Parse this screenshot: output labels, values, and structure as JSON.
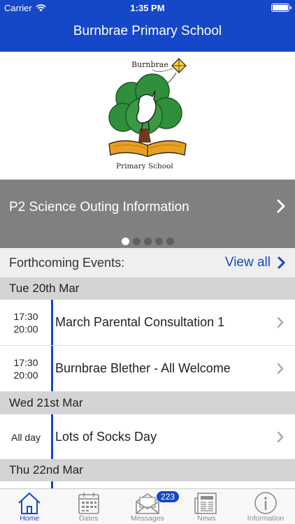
{
  "status_bar": {
    "carrier": "Carrier",
    "time": "1:35 PM"
  },
  "nav": {
    "title": "Burnbrae Primary School"
  },
  "logo": {
    "top_text": "Burnbrae",
    "bottom_text": "Primary School"
  },
  "carousel": {
    "title": "P2 Science Outing Information",
    "page_count": 5,
    "active_index": 0
  },
  "events": {
    "header_label": "Forthcoming Events:",
    "view_all_label": "View all",
    "days": [
      {
        "label": "Tue 20th Mar",
        "items": [
          {
            "start": "17:30",
            "end": "20:00",
            "title": "March Parental Consultation 1"
          },
          {
            "start": "17:30",
            "end": "20:00",
            "title": "Burnbrae Blether - All Welcome"
          }
        ]
      },
      {
        "label": "Wed 21st Mar",
        "items": [
          {
            "all_day": "All day",
            "title": "Lots of Socks Day"
          }
        ]
      },
      {
        "label": "Thu 22nd Mar",
        "items": []
      }
    ]
  },
  "tabbar": {
    "tabs": [
      {
        "label": "Home",
        "icon": "home-icon",
        "active": true
      },
      {
        "label": "Dates",
        "icon": "calendar-icon"
      },
      {
        "label": "Messages",
        "icon": "envelope-icon",
        "badge": "223"
      },
      {
        "label": "News",
        "icon": "newspaper-icon"
      },
      {
        "label": "Information",
        "icon": "info-icon"
      }
    ]
  },
  "colors": {
    "brand_blue": "#1547c9",
    "carousel_gray": "#808080",
    "day_header_gray": "#d4d4d6"
  }
}
